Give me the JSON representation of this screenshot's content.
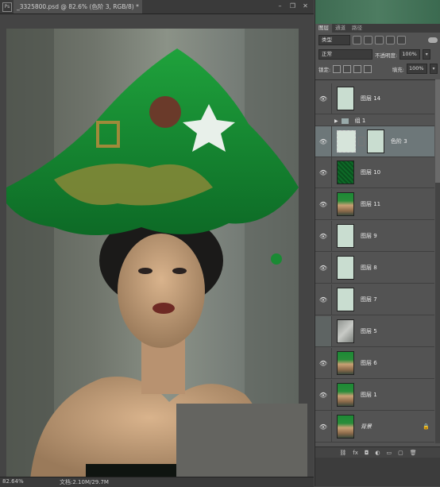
{
  "document": {
    "tab_title": "_3325800.psd @ 82.6% (色阶 3, RGB/8) *",
    "zoom": "82.64%",
    "doc_info": "文档:2.10M/29.7M"
  },
  "window_buttons": [
    "–",
    "❐",
    "✕"
  ],
  "panel": {
    "tabs": [
      "图层",
      "通道",
      "路径"
    ],
    "filter_kind": "类型",
    "blend_mode": "正常",
    "opacity_label": "不透明度:",
    "opacity_value": "100%",
    "lock_label": "锁定:",
    "fill_label": "填充:",
    "fill_value": "100%"
  },
  "layers": [
    {
      "name": "图层 14",
      "thumb": "mint"
    },
    {
      "name": "组 1",
      "type": "group"
    },
    {
      "name": "色阶 3",
      "thumb": "adjustment",
      "selected": true
    },
    {
      "name": "图层 10",
      "thumb": "green"
    },
    {
      "name": "图层 11",
      "thumb": "photo"
    },
    {
      "name": "图层 9",
      "thumb": "mint"
    },
    {
      "name": "图层 8",
      "thumb": "mint"
    },
    {
      "name": "图层 7",
      "thumb": "mint"
    },
    {
      "name": "图层 5",
      "thumb": "gray"
    },
    {
      "name": "图层 6",
      "thumb": "photo"
    },
    {
      "name": "图层 1",
      "thumb": "photo"
    },
    {
      "name": "背景",
      "thumb": "photo",
      "locked": true
    }
  ],
  "bottom_icons": [
    "link-icon",
    "fx-icon",
    "mask-icon",
    "adjustment-icon",
    "folder-icon",
    "new-layer-icon",
    "trash-icon"
  ],
  "colors": {
    "selected_layer": "#6d7779",
    "panel_bg": "#535353",
    "canvas_bg": "#444444"
  }
}
